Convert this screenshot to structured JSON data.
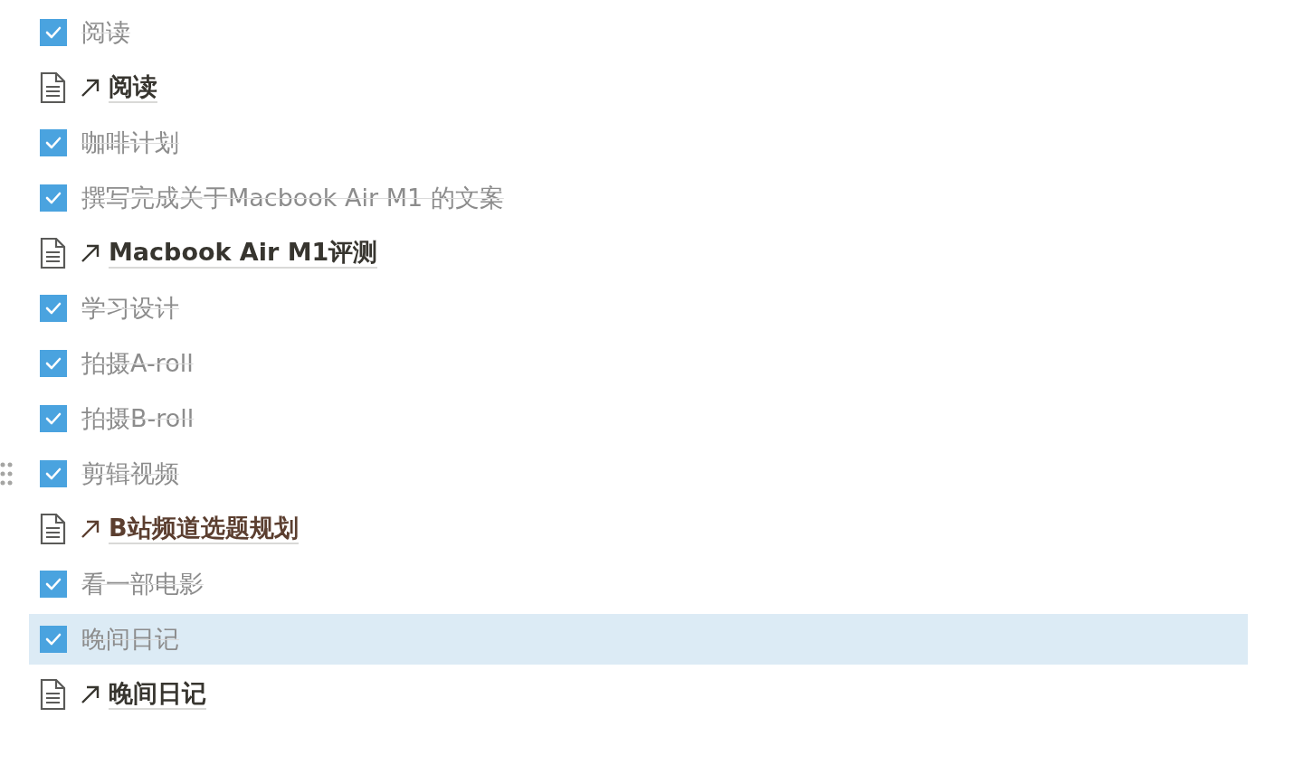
{
  "items": [
    {
      "kind": "todo",
      "text": "阅读",
      "checked": true,
      "selected": false,
      "handle": false
    },
    {
      "kind": "page",
      "text": "阅读",
      "color": "#37352f",
      "selected": false,
      "handle": false
    },
    {
      "kind": "todo",
      "text": "咖啡计划",
      "checked": true,
      "selected": false,
      "handle": false
    },
    {
      "kind": "todo",
      "text": "撰写完成关于Macbook Air M1 的文案",
      "checked": true,
      "selected": false,
      "handle": false
    },
    {
      "kind": "page",
      "text": "Macbook Air M1评测",
      "color": "#37352f",
      "selected": false,
      "handle": false
    },
    {
      "kind": "todo",
      "text": "学习设计",
      "checked": true,
      "selected": false,
      "handle": false
    },
    {
      "kind": "todo",
      "text": "拍摄A-roll",
      "checked": true,
      "selected": false,
      "handle": false
    },
    {
      "kind": "todo",
      "text": "拍摄B-roll",
      "checked": true,
      "selected": false,
      "handle": false
    },
    {
      "kind": "todo",
      "text": "剪辑视频",
      "checked": true,
      "selected": false,
      "handle": true
    },
    {
      "kind": "page",
      "text": "B站频道选题规划",
      "color": "#5b3e2f",
      "selected": false,
      "handle": false
    },
    {
      "kind": "todo",
      "text": "看一部电影",
      "checked": true,
      "selected": false,
      "handle": false
    },
    {
      "kind": "todo",
      "text": "晚间日记",
      "checked": true,
      "selected": true,
      "handle": false
    },
    {
      "kind": "page",
      "text": "晚间日记",
      "color": "#37352f",
      "selected": false,
      "handle": false
    }
  ]
}
